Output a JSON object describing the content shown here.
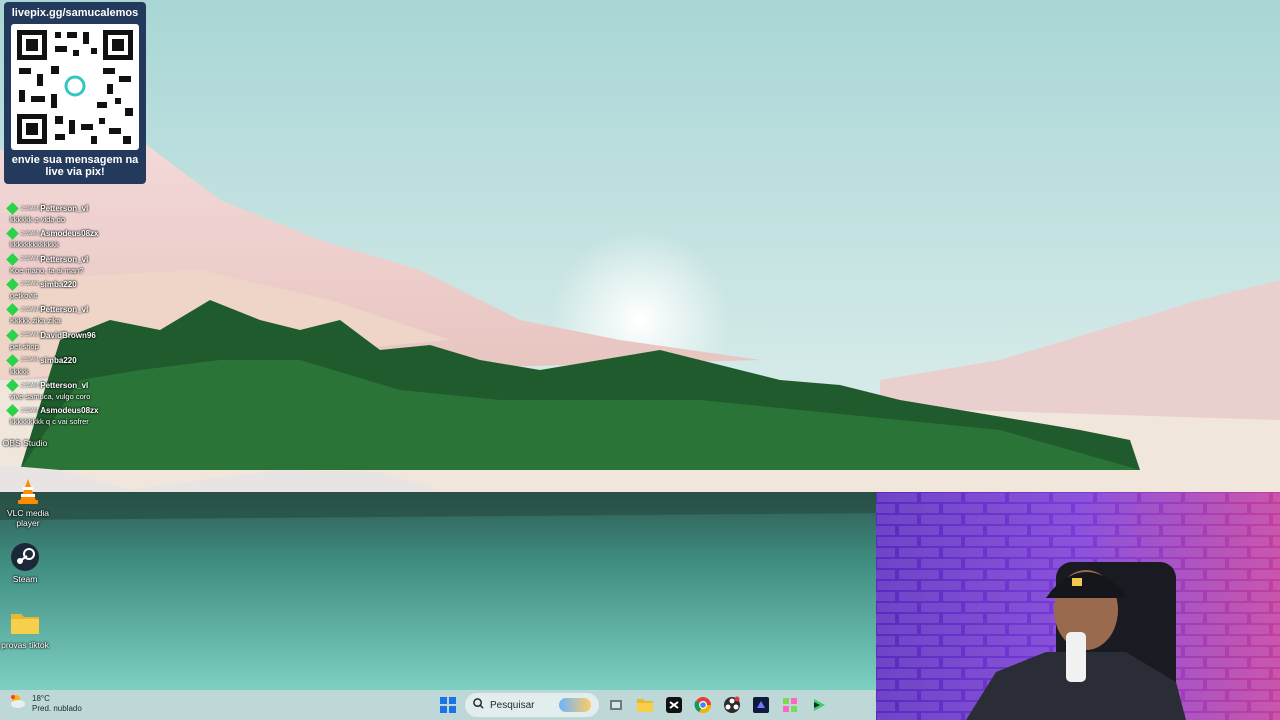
{
  "overlay": {
    "qr_url": "livepix.gg/samucalemos",
    "qr_message": "envie sua mensagem na live via pix!"
  },
  "desktop_icons": [
    {
      "label": "VLC media player",
      "icon": "vlc-cone-icon"
    },
    {
      "label": "Steam",
      "icon": "steam-icon"
    },
    {
      "label": "provas tiktok",
      "icon": "folder-icon"
    }
  ],
  "chat": [
    {
      "user": "Petterson_vl",
      "time": "2:59AM",
      "text": "kkkkkk a vida do"
    },
    {
      "user": "Asmodeus08zx",
      "time": "2:59AM",
      "text": "kkkkkkkkkkkkk"
    },
    {
      "user": "Petterson_vl",
      "time": "2:59AM",
      "text": "Koe mano, ta ai man?"
    },
    {
      "user": "simba220",
      "time": "2:59AM",
      "text": "petkovic"
    },
    {
      "user": "Petterson_vl",
      "time": "2:59AM",
      "text": "Kkkkk zika zika"
    },
    {
      "user": "DavidBrown96",
      "time": "2:59AM",
      "text": "pet shop"
    },
    {
      "user": "simba220",
      "time": "2:59AM",
      "text": "kkkkk"
    },
    {
      "user": "Petterson_vl",
      "time": "2:59AM",
      "text": "vive samuca, vulgo coro"
    },
    {
      "user": "Asmodeus08zx",
      "time": "2:59AM",
      "text": "kkkkkkkkk q c vai sofrer"
    }
  ],
  "desktop_labels_partial": [
    "Steam",
    "OBS Studio"
  ],
  "taskbar": {
    "weather_temp": "18°C",
    "weather_desc": "Pred. nublado",
    "search_label": "Pesquisar"
  },
  "colors": {
    "overlay_bg": "#243a5c",
    "chat_badge": "#2bd34b"
  }
}
